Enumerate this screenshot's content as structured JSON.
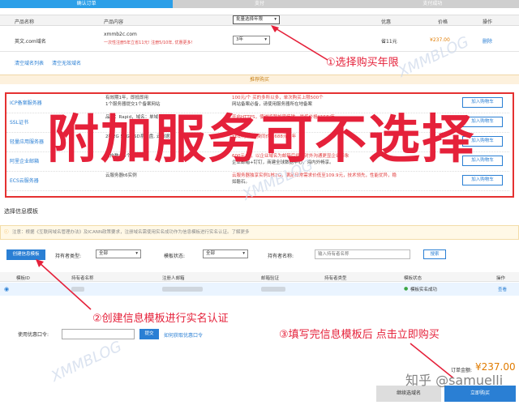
{
  "steps": [
    "确认订单",
    "支付",
    "支付成功"
  ],
  "header": {
    "product_name": "产品名称",
    "product_content": "产品内容",
    "quick_select": "批量选择年限",
    "discount": "优惠",
    "price": "价格",
    "action": "操作"
  },
  "order": {
    "name": "英文.com域名",
    "domain": "xmmb2c.com",
    "promo": "一次性注册5年立省11元! 注册5/10年, 优惠更多!",
    "years": "3年",
    "discount": "省11元",
    "price": "¥237.00",
    "delete": "删除"
  },
  "links": {
    "clear": "清空域名列表",
    "clear_invalid": "清空无效域名"
  },
  "recommend": "推荐购买",
  "services": [
    {
      "name": "ICP备案服务器",
      "d1": "有效期1年，即抵即用",
      "d2": "1个服务器提交1个备案网站",
      "p1": "100元/个  买的多所以多，单次购买上限500个",
      "p2": "网站备案必备，请使用服务器所在地备案",
      "add": "加入购物车"
    },
    {
      "name": "SSL证书",
      "d1": "品牌：Rapid，域名：单域名DV",
      "d2": "",
      "p1": "开启HTTPS，使浏览器加密传输，最低价格¥158/年",
      "p2": "",
      "add": "加入购物车"
    },
    {
      "name": "轻量应用服务器",
      "d1": "2核2G 50G SSD系统盘, 云数据盘",
      "d2": "",
      "p1": "¥61/月起 续费同价 1688元/1年",
      "p2": "",
      "add": "加入购物车"
    },
    {
      "name": "阿里企业邮箱",
      "d1": "",
      "d2": "账户数：5个",
      "p1": "600元/年，以企业域名为邮箱后缀，对外沟通更显企业形象",
      "p2": "企业邮箱+钉钉，商建全球数据中心，海内外畅享。",
      "add": "加入购物车"
    },
    {
      "name": "ECS云服务器",
      "d1": "云服务器t6实例",
      "d2": "",
      "p1": "云服务器独享实例1核2G，满足日常需求价低至109.9元，技术领先，性能优异，稳",
      "p2": "如磐石。",
      "add": "加入购物车"
    }
  ],
  "overlay_text": "附加服务可不选择",
  "section_title": "选择信息模板",
  "notice": "注意：根据《互联网域名管理办法》及ICANN政策要求，注册域名需使用实名成功作为信息模板进行实名认证。了解更多",
  "filters": {
    "create": "创建信息模板",
    "holder_type": "持有者类型:",
    "holder_type_val": "全部",
    "template_state": "模板状态:",
    "template_state_val": "全部",
    "holder_name": "持有者名称:",
    "holder_name_ph": "输入持有者名称",
    "search": "搜索"
  },
  "table": {
    "cols": [
      "模板ID",
      "持有者名称",
      "注册人邮箱",
      "邮箱验证",
      "持有者类型",
      "模板状态",
      "操作"
    ],
    "status": "模板实名成功",
    "view": "查看"
  },
  "annotations": {
    "a1": "①选择购买年限",
    "a2": "②创建信息模板进行实名认证",
    "a3": "③填写完信息模板后 点击立即购买"
  },
  "coupon": {
    "label": "使用优惠口令:",
    "btn": "提交",
    "link": "如何获取优惠口令"
  },
  "footer": {
    "total_label": "订单金额:",
    "total": "¥237.00",
    "continue": "继续选域名",
    "buy": "立即购买"
  },
  "watermarks": [
    "XMMBLOG",
    "XMMBLOG",
    "XMMBLOG",
    "知乎 @samuelli"
  ],
  "colors": {
    "accent": "#2c9fe8",
    "annotation": "#e5213a",
    "price": "#e07b00"
  }
}
